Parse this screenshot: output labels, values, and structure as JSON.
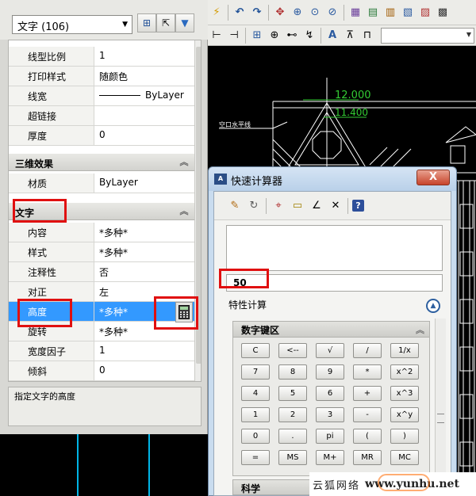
{
  "properties": {
    "object_type": "文字 (106)",
    "rows_general": [
      {
        "k": "线型比例",
        "v": "1"
      },
      {
        "k": "打印样式",
        "v": "随颜色"
      },
      {
        "k": "线宽",
        "v": "ByLayer"
      },
      {
        "k": "超链接",
        "v": ""
      },
      {
        "k": "厚度",
        "v": "0"
      }
    ],
    "section_3d": "三维效果",
    "rows_3d": [
      {
        "k": "材质",
        "v": "ByLayer"
      }
    ],
    "section_text": "文字",
    "rows_text": [
      {
        "k": "内容",
        "v": "*多种*"
      },
      {
        "k": "样式",
        "v": "*多种*"
      },
      {
        "k": "注释性",
        "v": "否"
      },
      {
        "k": "对正",
        "v": "左"
      },
      {
        "k": "高度",
        "v": "*多种*"
      },
      {
        "k": "旋转",
        "v": "*多种*"
      },
      {
        "k": "宽度因子",
        "v": "1"
      },
      {
        "k": "倾斜",
        "v": "0"
      }
    ],
    "description": "指定文字的高度"
  },
  "drawing": {
    "dim_top": "12.000",
    "dim_second": "11.400",
    "note_label": "空口水平线"
  },
  "quick_calc": {
    "title": "快速计算器",
    "close_label": "X",
    "input_value": "50",
    "special_calc_label": "特性计算",
    "keypad_label": "数字键区",
    "science_label": "科学",
    "keys": [
      [
        "C",
        "<--",
        "√",
        "/",
        "1/x"
      ],
      [
        "7",
        "8",
        "9",
        "*",
        "x^2"
      ],
      [
        "4",
        "5",
        "6",
        "+",
        "x^3"
      ],
      [
        "1",
        "2",
        "3",
        "-",
        "x^y"
      ],
      [
        "0",
        ".",
        "pi",
        "(",
        ")"
      ],
      [
        "=",
        "MS",
        "M+",
        "MR",
        "MC"
      ]
    ]
  },
  "watermark": {
    "text": "云狐网络",
    "url": "www.yunhu.net"
  },
  "colors": {
    "selection": "#3399ff",
    "highlight_box": "#e01010",
    "cad_line": "#ffffff",
    "dim_green": "#33cc33",
    "cyan": "#00b4e6"
  }
}
